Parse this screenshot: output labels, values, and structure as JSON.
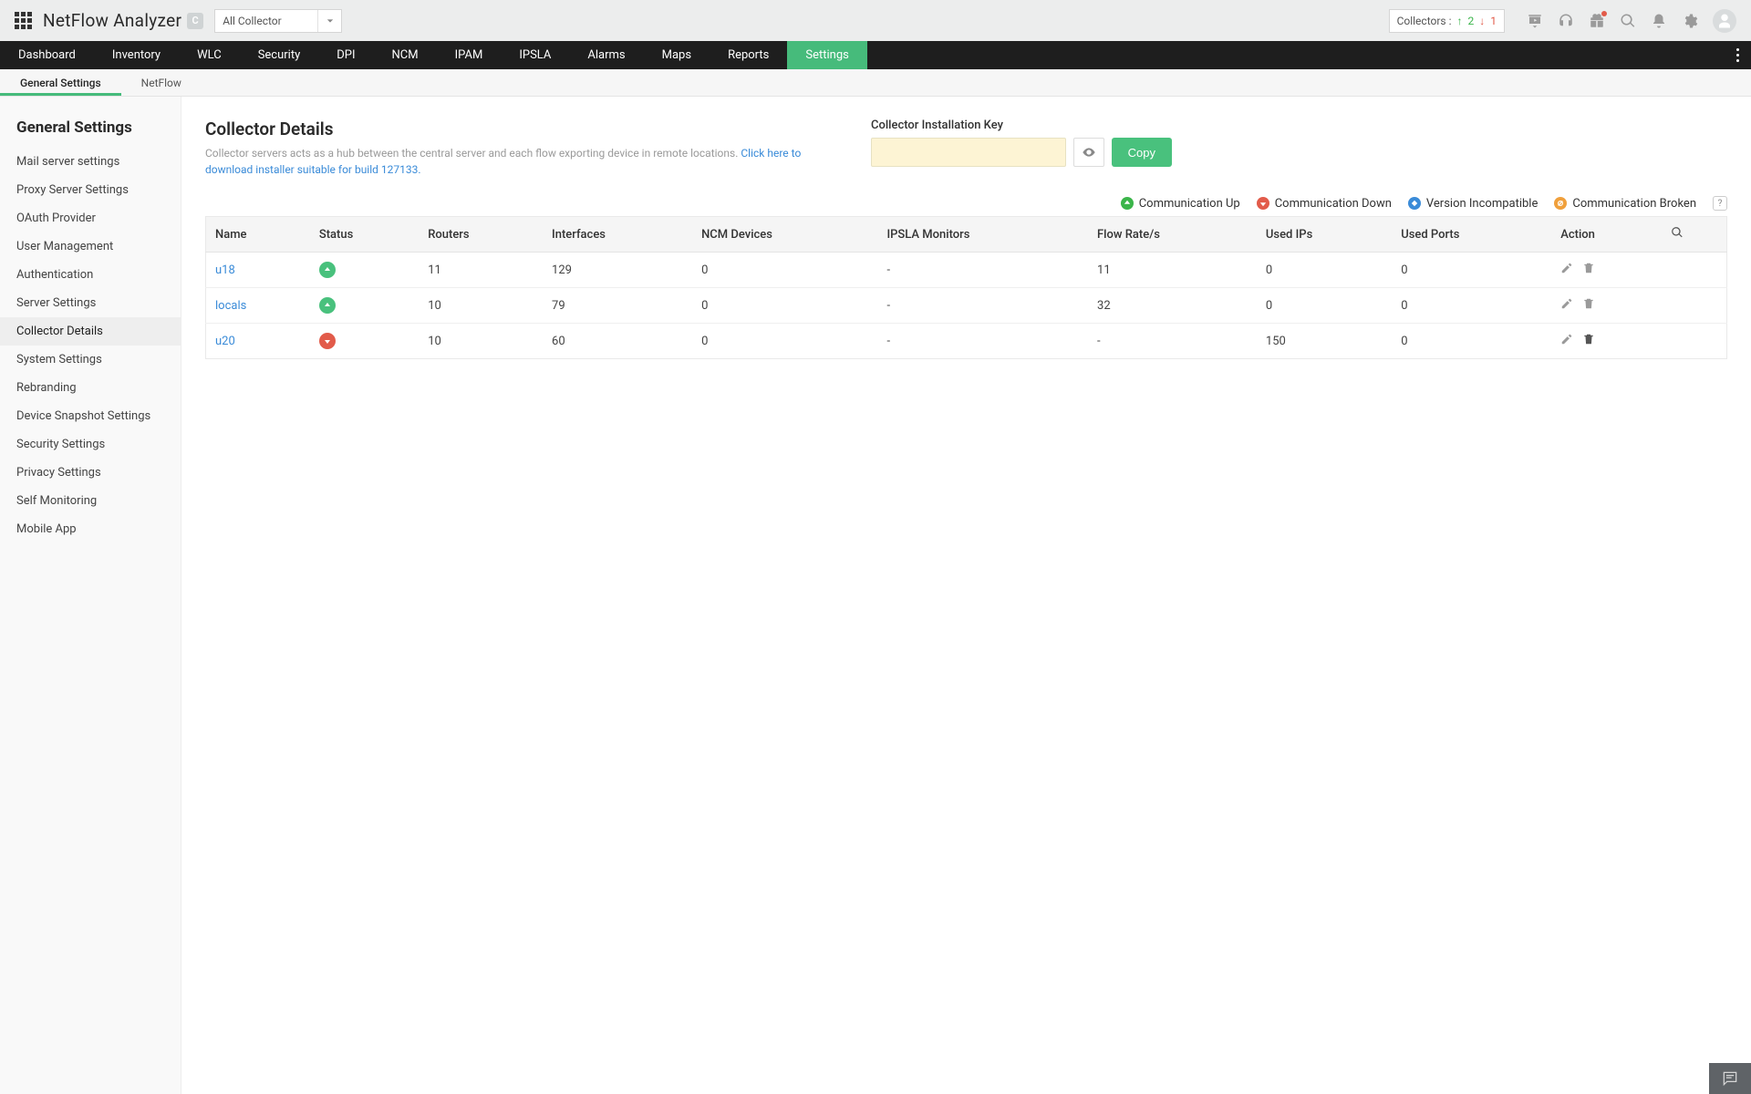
{
  "brand": {
    "name": "NetFlow Analyzer",
    "badge": "C"
  },
  "collector_dropdown": "All Collector",
  "collectors_status": {
    "label": "Collectors :",
    "up": "2",
    "down": "1"
  },
  "mainnav": [
    "Dashboard",
    "Inventory",
    "WLC",
    "Security",
    "DPI",
    "NCM",
    "IPAM",
    "IPSLA",
    "Alarms",
    "Maps",
    "Reports",
    "Settings"
  ],
  "mainnav_active": "Settings",
  "subnav": [
    "General Settings",
    "NetFlow"
  ],
  "subnav_active": "General Settings",
  "sidebar": {
    "title": "General Settings",
    "items": [
      "Mail server settings",
      "Proxy Server Settings",
      "OAuth Provider",
      "User Management",
      "Authentication",
      "Server Settings",
      "Collector Details",
      "System Settings",
      "Rebranding",
      "Device Snapshot Settings",
      "Security Settings",
      "Privacy Settings",
      "Self Monitoring",
      "Mobile App"
    ],
    "active": "Collector Details"
  },
  "page": {
    "title": "Collector Details",
    "desc": "Collector servers acts as a hub between the central server and each flow exporting device in remote locations. ",
    "link": "Click here to download installer suitable for build 127133."
  },
  "key": {
    "label": "Collector Installation Key",
    "copy": "Copy"
  },
  "legend": {
    "up": "Communication Up",
    "down": "Communication Down",
    "inc": "Version Incompatible",
    "broken": "Communication Broken",
    "help": "?"
  },
  "table": {
    "headers": [
      "Name",
      "Status",
      "Routers",
      "Interfaces",
      "NCM Devices",
      "IPSLA Monitors",
      "Flow Rate/s",
      "Used IPs",
      "Used Ports",
      "Action"
    ],
    "rows": [
      {
        "name": "u18",
        "status": "up",
        "routers": "11",
        "interfaces": "129",
        "ncm": "0",
        "ipsla": "-",
        "flow": "11",
        "ips": "0",
        "ports": "0",
        "del": false
      },
      {
        "name": "locals",
        "status": "up",
        "routers": "10",
        "interfaces": "79",
        "ncm": "0",
        "ipsla": "-",
        "flow": "32",
        "ips": "0",
        "ports": "0",
        "del": false
      },
      {
        "name": "u20",
        "status": "down",
        "routers": "10",
        "interfaces": "60",
        "ncm": "0",
        "ipsla": "-",
        "flow": "-",
        "ips": "150",
        "ports": "0",
        "del": true
      }
    ]
  }
}
